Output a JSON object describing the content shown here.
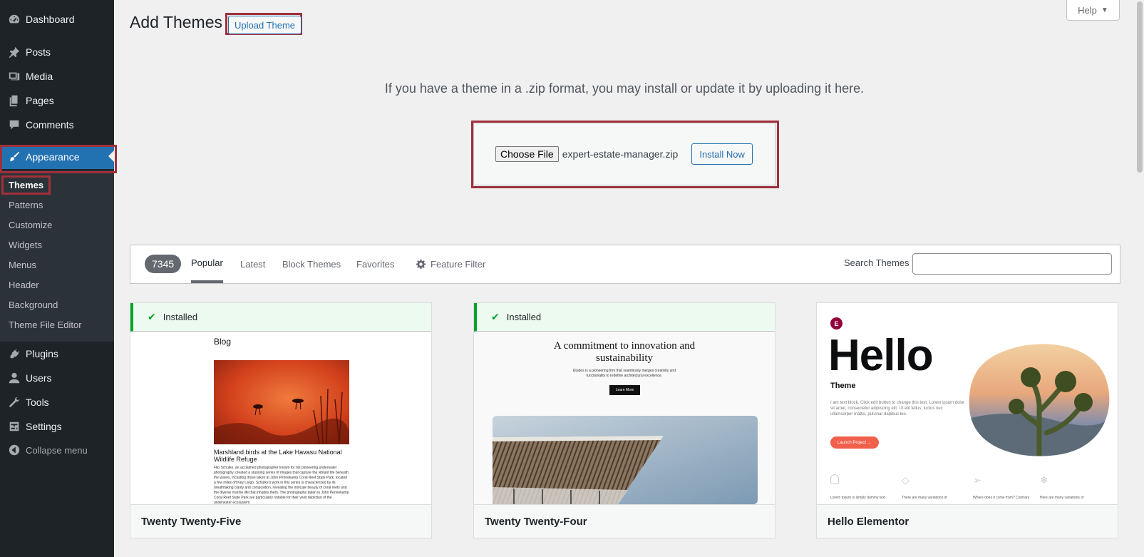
{
  "sidebar": {
    "items": [
      {
        "label": "Dashboard",
        "icon": "dashboard-icon"
      },
      {
        "label": "Posts",
        "icon": "pushpin-icon"
      },
      {
        "label": "Media",
        "icon": "media-icon"
      },
      {
        "label": "Pages",
        "icon": "pages-icon"
      },
      {
        "label": "Comments",
        "icon": "comment-icon"
      },
      {
        "label": "Appearance",
        "icon": "paintbrush-icon"
      },
      {
        "label": "Plugins",
        "icon": "plug-icon"
      },
      {
        "label": "Users",
        "icon": "user-icon"
      },
      {
        "label": "Tools",
        "icon": "wrench-icon"
      },
      {
        "label": "Settings",
        "icon": "settings-icon"
      }
    ],
    "submenu": [
      "Themes",
      "Patterns",
      "Customize",
      "Widgets",
      "Menus",
      "Header",
      "Background",
      "Theme File Editor"
    ],
    "collapse_label": "Collapse menu"
  },
  "header": {
    "title": "Add Themes",
    "upload_label": "Upload Theme",
    "help_label": "Help"
  },
  "upload": {
    "description": "If you have a theme in a .zip format, you may install or update it by uploading it here.",
    "choose_file_label": "Choose File",
    "file_name": "expert-estate-manager.zip",
    "install_label": "Install Now"
  },
  "filter": {
    "count": "7345",
    "tabs": [
      "Popular",
      "Latest",
      "Block Themes",
      "Favorites"
    ],
    "feature_filter": "Feature Filter",
    "search_label": "Search Themes",
    "search_value": ""
  },
  "themes": [
    {
      "name": "Twenty Twenty-Five",
      "installed": "Installed",
      "preview": {
        "heading": "Blog",
        "caption": "Marshland birds at the Lake Havasu National Wildlife Refuge",
        "body": "Flip Schulke, an acclaimed photographer known for his pioneering underwater photography, created a stunning series of images that capture the vibrant life beneath the waves, including those taken at John Pennekamp Coral Reef State Park, located a few miles off Key Largo. Schulke's work in this series is characterized by its breathtaking clarity and composition, revealing the intricate beauty of coral reefs and the diverse marine life that inhabits them. The photographs taken in John Pennekamp Coral Reef State Park are particularly notable for their vivid depiction of the underwater ecosystem."
      }
    },
    {
      "name": "Twenty Twenty-Four",
      "installed": "Installed",
      "preview": {
        "heading": "A commitment to innovation and sustainability",
        "body": "Études is a pioneering firm that seamlessly merges creativity and functionality to redefine architectural excellence.",
        "button": "Learn More"
      }
    },
    {
      "name": "Hello Elementor",
      "preview": {
        "logo": "E",
        "heading": "Hello",
        "subheading": "Theme",
        "body": "I am text block. Click edit button to change this text. Lorem ipsum dolor sit amet, consectetur adipiscing elit. Ut elit tellus, luctus nec ullamcorper mattis, pulvinar dapibus leo.",
        "button": "Launch Project →",
        "features": [
          "Lorem Ipsum is simply dummy text",
          "There are many variations of",
          "Where does it come from? Contrary",
          "Here are many variations of"
        ]
      }
    }
  ],
  "colors": {
    "sidebar_bg": "#1d2327",
    "accent": "#2271b1",
    "highlight": "#a0303c",
    "installed_green": "#00a32a",
    "hello_red": "#f0604b"
  }
}
